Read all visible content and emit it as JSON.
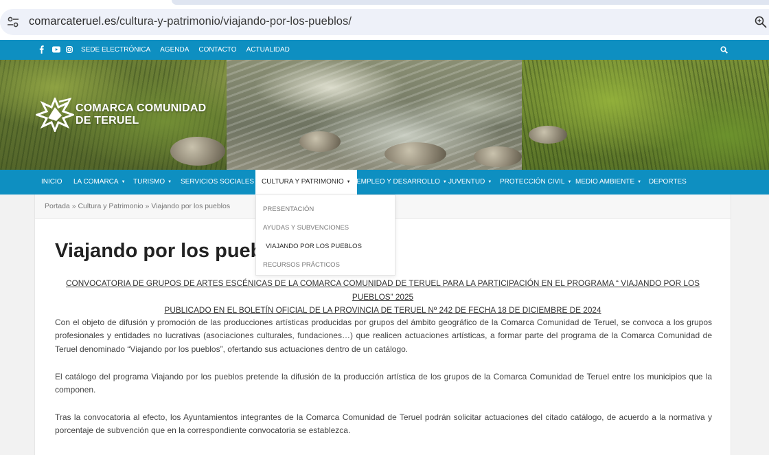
{
  "browser": {
    "url_domain": "comarcateruel.es",
    "url_path": "/cultura-y-patrimonio/viajando-por-los-pueblos/"
  },
  "topbar": {
    "links": [
      "SEDE ELECTRÓNICA",
      "AGENDA",
      "CONTACTO",
      "ACTUALIDAD"
    ],
    "social_icons": [
      "facebook-icon",
      "youtube-icon",
      "instagram-icon"
    ]
  },
  "brand": {
    "line1": "COMARCA COMUNIDAD",
    "line2": "DE TERUEL"
  },
  "nav": {
    "items": [
      {
        "label": "INICIO",
        "dropdown": false
      },
      {
        "label": "LA COMARCA",
        "dropdown": true
      },
      {
        "label": "TURISMO",
        "dropdown": true
      },
      {
        "label": "SERVICIOS SOCIALES",
        "dropdown": true
      },
      {
        "label": "CULTURA Y PATRIMONIO",
        "dropdown": true
      },
      {
        "label": "EMPLEO Y DESARROLLO",
        "dropdown": true
      },
      {
        "label": "JUVENTUD",
        "dropdown": true
      },
      {
        "label": "PROTECCIÓN CIVIL",
        "dropdown": true
      },
      {
        "label": "MEDIO AMBIENTE",
        "dropdown": true
      },
      {
        "label": "DEPORTES",
        "dropdown": false
      }
    ],
    "caret": "▼",
    "submenu": [
      "PRESENTACIÓN",
      "AYUDAS Y SUBVENCIONES",
      "VIAJANDO POR LOS PUEBLOS",
      "RECURSOS PRÁCTICOS"
    ]
  },
  "breadcrumb": {
    "home": "Portada",
    "sep": " » ",
    "section": "Cultura y Patrimonio",
    "current": "Viajando por los pueblos"
  },
  "page": {
    "title": "Viajando por los pueblos",
    "convocatoria_line1": "CONVOCATORIA DE GRUPOS DE ARTES ESCÉNICAS DE LA COMARCA COMUNIDAD DE TERUEL PARA LA PARTICIPACIÓN EN EL PROGRAMA “ VIAJANDO POR LOS PUEBLOS” 2025",
    "convocatoria_line2": "PUBLICADO EN EL BOLETÍN OFICIAL DE LA PROVINCIA DE TERUEL Nº 242 DE FECHA 18 DE DICIEMBRE DE 2024",
    "paragraphs": [
      "Con el objeto de difusión y promoción de las producciones artísticas producidas por grupos del ámbito geográfico  de la Comarca Comunidad de Teruel, se convoca a los grupos profesionales y entidades no lucrativas (asociaciones culturales, fundaciones…) que realicen actuaciones artísticas, a formar parte del programa de la Comarca Comunidad de Teruel denominado “Viajando por los pueblos”, ofertando sus actuaciones dentro de un catálogo.",
      "El catálogo del programa Viajando por los pueblos pretende la difusión de la producción artística de los grupos de la Comarca Comunidad de Teruel entre los municipios que la componen.",
      "Tras la convocatoria al efecto, los Ayuntamientos integrantes de la Comarca Comunidad de Teruel podrán solicitar actuaciones del citado catálogo, de acuerdo a la normativa y porcentaje de subvención que en la correspondiente convocatoria se establezca."
    ]
  },
  "colors": {
    "brand_blue": "#0e8fc1",
    "text": "#444444"
  }
}
